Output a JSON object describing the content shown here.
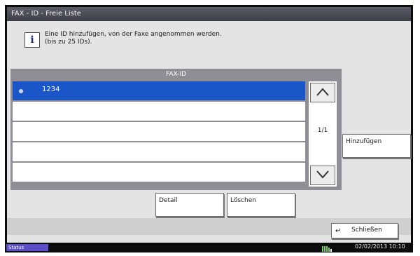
{
  "window": {
    "title": "FAX - ID - Freie Liste"
  },
  "info": {
    "icon": "info-icon",
    "line1": "Eine ID hinzufügen, von der Faxe angenommen werden.",
    "line2": "(bis zu 25 IDs)."
  },
  "list": {
    "header": "FAX-ID",
    "rows": [
      "1234",
      "",
      "",
      "",
      ""
    ],
    "selected_index": 0,
    "page_indicator": "1/1"
  },
  "buttons": {
    "add": "Hinzufügen",
    "detail": "Detail",
    "delete": "Löschen",
    "close": "Schließen"
  },
  "status": {
    "label": "Status",
    "datetime": "02/02/2013  10:10"
  },
  "colors": {
    "selection": "#1a56c8",
    "status_button": "#5a4fc7",
    "title_bar": "#4a4a52"
  }
}
